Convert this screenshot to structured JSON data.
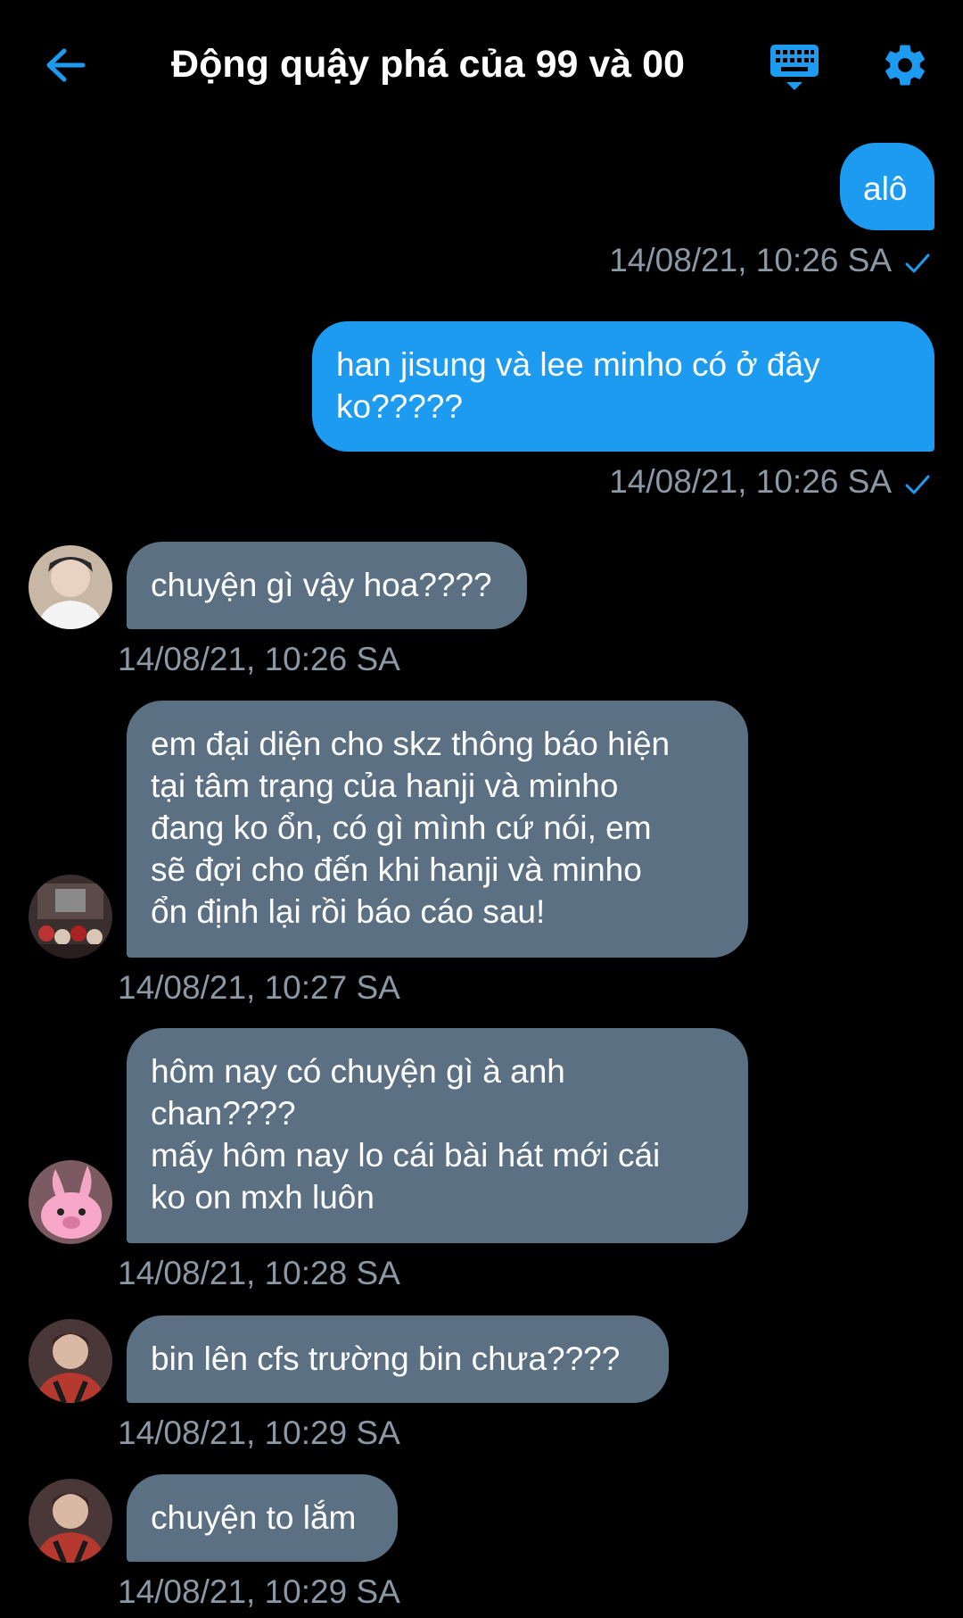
{
  "header": {
    "title": "Động quậy phá của 99 và 00",
    "back_icon": "arrow-left-icon",
    "keyboard_icon": "keyboard-icon",
    "settings_icon": "gear-icon"
  },
  "colors": {
    "accent": "#1d9bf0",
    "received_bubble": "#5b7083",
    "timestamp": "#8b98a5",
    "background": "#000000"
  },
  "messages": [
    {
      "direction": "sent",
      "text": "alô",
      "time": "14/08/21, 10:26 SA"
    },
    {
      "direction": "sent",
      "text": "han jisung và lee minho có ở đây\nko?????",
      "time": "14/08/21, 10:26 SA"
    },
    {
      "direction": "received",
      "text": "chuyện gì vậy hoa????",
      "time": "14/08/21, 10:26 SA"
    },
    {
      "direction": "received",
      "text": "em đại diện cho skz thông báo hiện\ntại tâm trạng của hanji và minho\nđang ko ổn, có gì mình cứ nói, em\nsẽ đợi cho đến khi hanji và minho\nổn định lại rồi báo cáo sau!",
      "time": "14/08/21, 10:27 SA"
    },
    {
      "direction": "received",
      "text": "hôm nay có chuyện gì à anh\nchan????\nmấy hôm nay lo cái bài hát mới cái\nko on mxh luôn",
      "time": "14/08/21, 10:28 SA"
    },
    {
      "direction": "received",
      "text": "bin lên cfs trường bin chưa????",
      "time": "14/08/21, 10:29 SA"
    },
    {
      "direction": "received",
      "text": "chuyện to lắm",
      "time": "14/08/21, 10:29 SA"
    }
  ]
}
